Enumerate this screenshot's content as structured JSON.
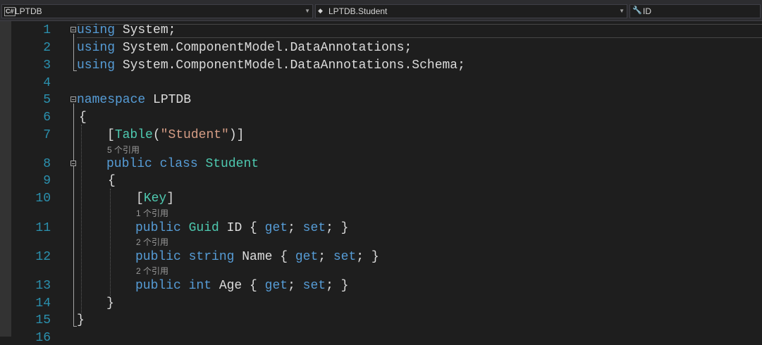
{
  "navbar": {
    "project": {
      "icon": "csharp-project-icon",
      "label": "LPTDB"
    },
    "type": {
      "icon": "class-icon",
      "label": "LPTDB.Student"
    },
    "member": {
      "icon": "wrench-icon",
      "label": "ID"
    }
  },
  "editor": {
    "line_numbers": [
      "1",
      "2",
      "3",
      "4",
      "5",
      "6",
      "7",
      "8",
      "9",
      "10",
      "11",
      "12",
      "13",
      "14",
      "15",
      "16"
    ],
    "codelens": {
      "class_refs": "5 个引用",
      "id_refs": "1 个引用",
      "name_refs": "2 个引用",
      "age_refs": "2 个引用"
    },
    "code": {
      "l1": [
        "using",
        " System;"
      ],
      "l2": [
        "using",
        " System.ComponentModel.DataAnnotations;"
      ],
      "l3": [
        "using",
        " System.ComponentModel.DataAnnotations.Schema;"
      ],
      "l5": [
        "namespace",
        " LPTDB"
      ],
      "l6": [
        "{"
      ],
      "l7": [
        "[",
        "Table",
        "(",
        "\"Student\"",
        ")]"
      ],
      "l8": [
        "public",
        " ",
        "class",
        " ",
        "Student"
      ],
      "l9": [
        "{"
      ],
      "l10": [
        "[",
        "Key",
        "]"
      ],
      "l11": [
        "public",
        " ",
        "Guid",
        " ID { ",
        "get",
        "; ",
        "set",
        "; }"
      ],
      "l12": [
        "public",
        " ",
        "string",
        " Name { ",
        "get",
        "; ",
        "set",
        "; }"
      ],
      "l13": [
        "public",
        " ",
        "int",
        " Age { ",
        "get",
        "; ",
        "set",
        "; }"
      ],
      "l14": [
        "}"
      ],
      "l15": [
        "}"
      ]
    },
    "colors": {
      "background": "#1e1e1e",
      "keyword": "#569cd6",
      "type": "#4ec9b0",
      "string": "#d69d85",
      "line_number": "#2b91af",
      "codelens": "#999999"
    }
  }
}
